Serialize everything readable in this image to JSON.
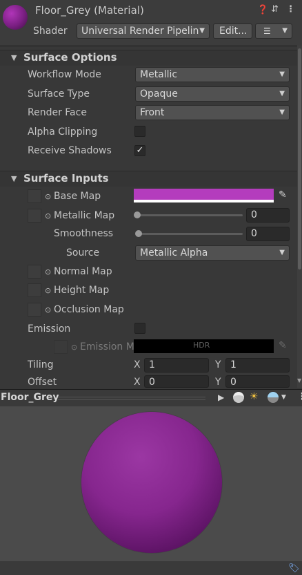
{
  "header": {
    "title": "Floor_Grey (Material)",
    "shader_label": "Shader",
    "shader_value": "Universal Render Pipelin",
    "edit_label": "Edit...",
    "help_icon": "help-icon",
    "settings_icon": "settings-sliders-icon",
    "more_icon": "kebab-menu-icon",
    "list_icon": "list-icon"
  },
  "surface_options": {
    "title": "Surface Options",
    "rows": [
      {
        "label": "Workflow Mode",
        "value": "Metallic"
      },
      {
        "label": "Surface Type",
        "value": "Opaque"
      },
      {
        "label": "Render Face",
        "value": "Front"
      }
    ],
    "alpha_clipping": {
      "label": "Alpha Clipping",
      "checked": false
    },
    "receive_shadows": {
      "label": "Receive Shadows",
      "checked": true,
      "check_glyph": "✓"
    }
  },
  "surface_inputs": {
    "title": "Surface Inputs",
    "base_map": {
      "label": "Base Map",
      "color": "#b43cbd"
    },
    "metallic_map": {
      "label": "Metallic Map",
      "value": "0",
      "slider": 0
    },
    "smoothness": {
      "label": "Smoothness",
      "value": "0",
      "slider": 0
    },
    "source": {
      "label": "Source",
      "value": "Metallic Alpha"
    },
    "normal_map": {
      "label": "Normal Map"
    },
    "height_map": {
      "label": "Height Map"
    },
    "occlusion_map": {
      "label": "Occlusion Map"
    },
    "emission": {
      "label": "Emission",
      "checked": false
    },
    "emission_map": {
      "label": "Emission M",
      "hdr_label": "HDR",
      "color": "#000000"
    },
    "tiling": {
      "label": "Tiling",
      "x_label": "X",
      "x": "1",
      "y_label": "Y",
      "y": "1"
    },
    "offset": {
      "label": "Offset",
      "x_label": "X",
      "x": "0",
      "y_label": "Y",
      "y": "0"
    }
  },
  "preview": {
    "title": "Floor_Grey",
    "sphere_color": "#86268e",
    "icons": [
      "play-icon",
      "mesh-sphere-icon",
      "light-icon",
      "environment-icon",
      "kebab-menu-icon"
    ]
  }
}
